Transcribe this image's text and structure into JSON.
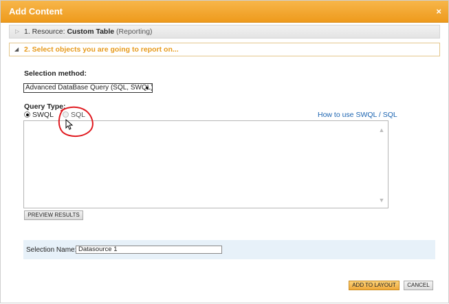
{
  "dialog": {
    "title": "Add Content",
    "close_glyph": "×"
  },
  "step1": {
    "prefix": "1. Resource: ",
    "bold": "Custom Table",
    "suffix": " (Reporting)",
    "expand_icon": "triangle-right-icon"
  },
  "step2": {
    "label": "2. Select objects you are going to report on...",
    "expand_icon": "triangle-down-icon"
  },
  "selection_method": {
    "label": "Selection method:",
    "selected_value": "Advanced DataBase Query (SQL, SWQL)"
  },
  "query_type": {
    "label": "Query Type:",
    "options": [
      {
        "label": "SWQL",
        "checked": true
      },
      {
        "label": "SQL",
        "checked": false
      }
    ],
    "help_link": "How to use SWQL / SQL"
  },
  "query_editor": {
    "value": ""
  },
  "buttons": {
    "preview": "PREVIEW RESULTS",
    "add_to_layout": "ADD TO LAYOUT",
    "cancel": "CANCEL"
  },
  "selection_name": {
    "label": "Selection Name:",
    "value": "Datasource 1"
  },
  "colors": {
    "title_bar": "#ee9a1c",
    "step_active_text": "#e79a1b",
    "link": "#1a63b0",
    "annotation_circle": "#e0191f",
    "selection_panel": "#e7f1f9"
  }
}
